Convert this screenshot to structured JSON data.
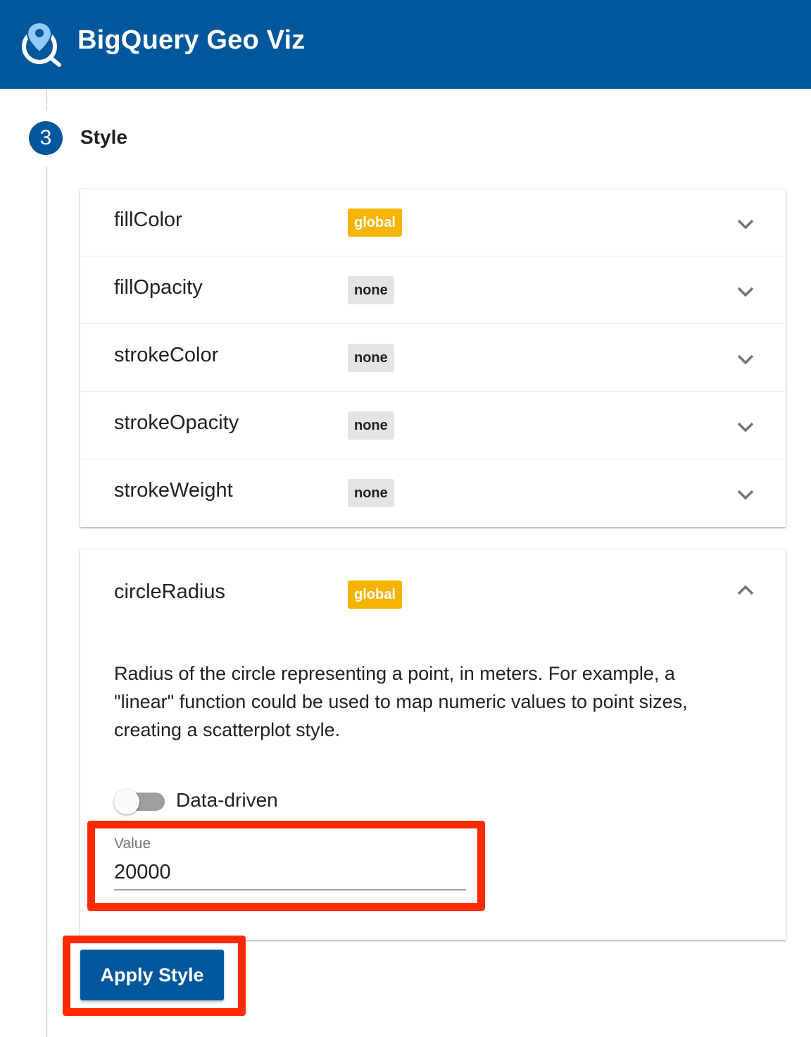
{
  "app": {
    "title": "BigQuery Geo Viz"
  },
  "step": {
    "number": "3",
    "title": "Style"
  },
  "properties": [
    {
      "name": "fillColor",
      "badge": "global"
    },
    {
      "name": "fillOpacity",
      "badge": "none"
    },
    {
      "name": "strokeColor",
      "badge": "none"
    },
    {
      "name": "strokeOpacity",
      "badge": "none"
    },
    {
      "name": "strokeWeight",
      "badge": "none"
    }
  ],
  "expanded": {
    "name": "circleRadius",
    "badge": "global",
    "description": "Radius of the circle representing a point, in meters. For example, a \"linear\" function could be used to map numeric values to point sizes, creating a scatterplot style.",
    "toggle_label": "Data-driven",
    "toggle_on": false,
    "field_label": "Value",
    "field_value": "20000"
  },
  "apply_label": "Apply Style",
  "colors": {
    "header": "#01579b",
    "badge_global": "#f4b400",
    "badge_none": "#e4e4e4",
    "highlight": "#ff2a00"
  },
  "icons": {
    "logo": "map-pin-search-icon",
    "expand": "chevron-down-icon",
    "collapse": "chevron-up-icon"
  }
}
